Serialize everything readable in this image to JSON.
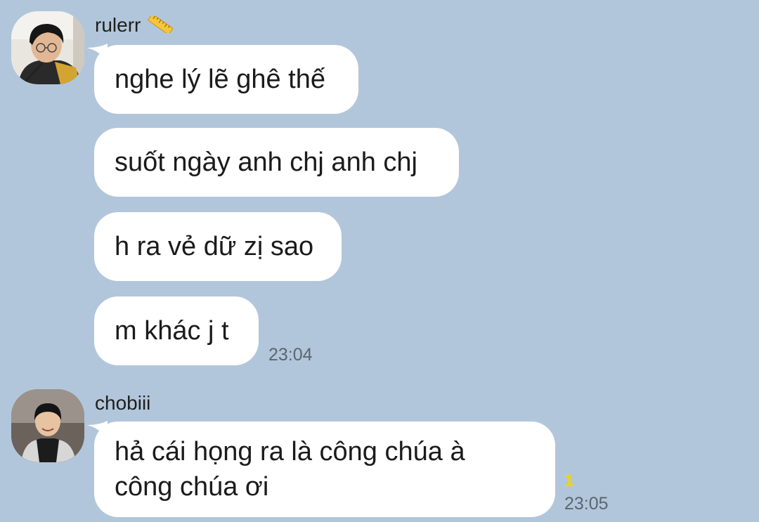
{
  "chat": {
    "group1": {
      "sender": "rulerr",
      "sender_badge_icon": "ruler-icon",
      "messages": [
        "nghe lý lẽ ghê thế",
        "suốt ngày anh chj anh chj",
        "h ra vẻ dữ zị sao",
        "m khác j t"
      ],
      "time": "23:04"
    },
    "group2": {
      "sender": "chobiii",
      "message_line1": "hả cái họng ra là công chúa à",
      "message_line2": "công chúa ơi",
      "unread_count": "1",
      "time": "23:05"
    }
  },
  "colors": {
    "background": "#b2c6db",
    "bubble": "#ffffff",
    "unread": "#f2d600",
    "time_text": "#5b6670"
  }
}
